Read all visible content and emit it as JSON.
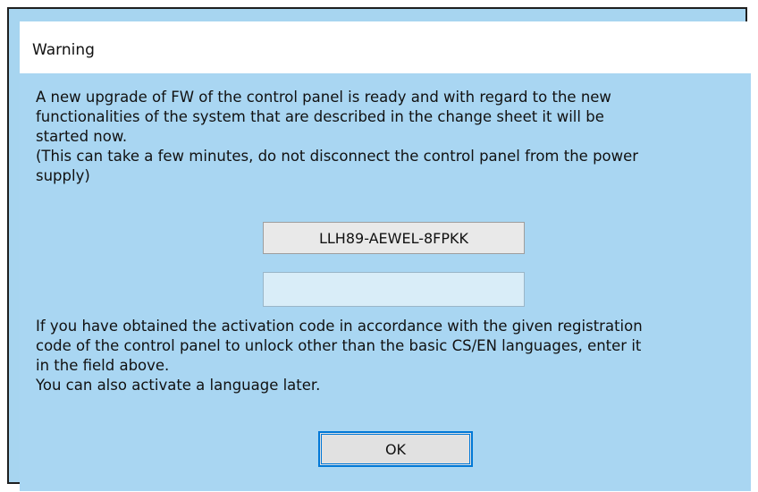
{
  "dialog": {
    "title": "Warning",
    "message_top": "A new upgrade of FW of the control panel is ready and with regard to the new\nfunctionalities of the system that are described in the change sheet it will be\nstarted now.\n(This can take a few minutes, do not disconnect the control panel from the power\nsupply)",
    "registration_code": "LLH89-AEWEL-8FPKK",
    "activation_input": {
      "value": "",
      "placeholder": ""
    },
    "message_bottom": "If you have obtained the activation code in accordance with the given registration\ncode of the control panel to unlock other than the basic CS/EN languages, enter it\nin the field above.\nYou can also activate a language later.",
    "ok_label": "OK"
  },
  "colors": {
    "content_background": "#a9d6f2",
    "title_background": "#ffffff",
    "focus_border": "#0078d7"
  }
}
